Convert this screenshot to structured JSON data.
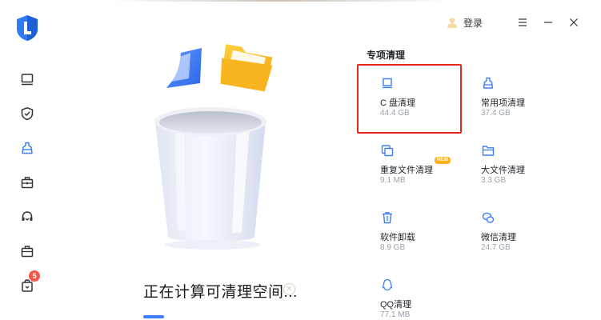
{
  "app": {
    "login_label": "登录",
    "accent_color": "#3d7ff6",
    "highlight_color": "#e2291f"
  },
  "sidebar": {
    "items": [
      {
        "name": "sidebar-item-monitor",
        "icon": "monitor-icon"
      },
      {
        "name": "sidebar-item-security",
        "icon": "shield-check-icon"
      },
      {
        "name": "sidebar-item-cleanup",
        "icon": "broom-icon",
        "active": true
      },
      {
        "name": "sidebar-item-toolbox",
        "icon": "toolbox-icon"
      },
      {
        "name": "sidebar-item-support",
        "icon": "headset-icon"
      },
      {
        "name": "sidebar-item-software",
        "icon": "briefcase-icon"
      },
      {
        "name": "sidebar-item-messages",
        "icon": "bag-icon",
        "badge": "5"
      }
    ]
  },
  "main": {
    "status_text": "正在计算可清理空间...",
    "progress_fraction": 0.05
  },
  "special_cleanup": {
    "title": "专项清理",
    "tiles": [
      {
        "name": "C 盘清理",
        "size": "44.4 GB",
        "icon": "drive-icon",
        "highlighted": true
      },
      {
        "name": "常用项清理",
        "size": "37.4 GB",
        "icon": "broom-icon"
      },
      {
        "name": "重复文件清理",
        "size": "9.1 MB",
        "icon": "duplicate-files-icon",
        "tag": "NEW"
      },
      {
        "name": "大文件清理",
        "size": "3.3 GB",
        "icon": "folder-icon"
      },
      {
        "name": "软件卸载",
        "size": "8.9 GB",
        "icon": "trash-icon"
      },
      {
        "name": "微信清理",
        "size": "24.7 GB",
        "icon": "wechat-icon"
      },
      {
        "name": "QQ清理",
        "size": "77.1 MB",
        "icon": "qq-icon"
      }
    ]
  }
}
